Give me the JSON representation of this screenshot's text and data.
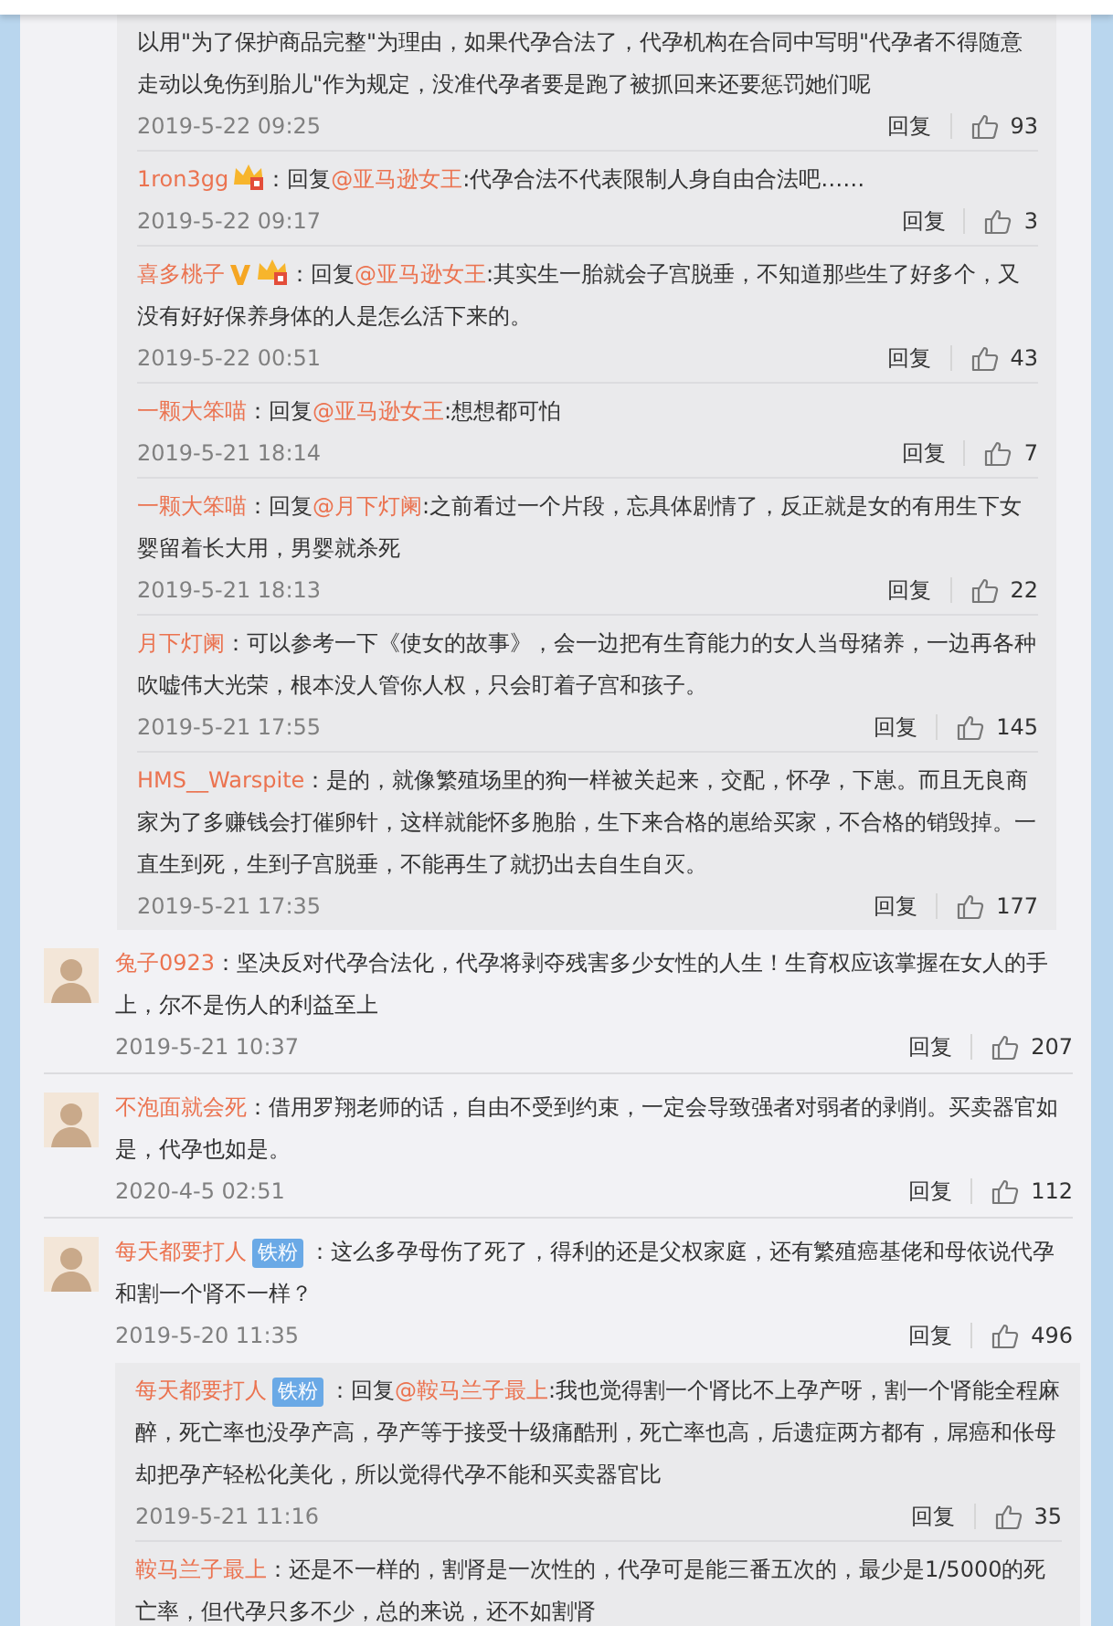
{
  "sections": [
    {
      "kind": "replies",
      "replies": [
        {
          "body": [
            {
              "kind": "text",
              "text": "以用\"为了保护商品完整\"为理由，如果代孕合法了，代孕机构在合同中写明\"代孕者不得随意走动以免伤到胎儿\"作为规定，没准代孕者要是跑了被抓回来还要惩罚她们呢"
            }
          ],
          "time": "2019-5-22 09:25",
          "reply_label": "回复",
          "likes": "93"
        },
        {
          "user": "1ron3gg",
          "badges": [
            {
              "kind": "level"
            }
          ],
          "body": [
            {
              "kind": "text",
              "text": "：回复"
            },
            {
              "kind": "mention",
              "text": "@亚马逊女王"
            },
            {
              "kind": "text",
              "text": ":代孕合法不代表限制人身自由合法吧……"
            }
          ],
          "time": "2019-5-22 09:17",
          "reply_label": "回复",
          "likes": "3"
        },
        {
          "user": "喜多桃子",
          "badges": [
            {
              "kind": "vip"
            },
            {
              "kind": "level"
            }
          ],
          "body": [
            {
              "kind": "text",
              "text": "：回复"
            },
            {
              "kind": "mention",
              "text": "@亚马逊女王"
            },
            {
              "kind": "text",
              "text": ":其实生一胎就会子宫脱垂，不知道那些生了好多个，又没有好好保养身体的人是怎么活下来的。"
            }
          ],
          "time": "2019-5-22 00:51",
          "reply_label": "回复",
          "likes": "43"
        },
        {
          "user": "一颗大笨喵",
          "body": [
            {
              "kind": "text",
              "text": "：回复"
            },
            {
              "kind": "mention",
              "text": "@亚马逊女王"
            },
            {
              "kind": "text",
              "text": ":想想都可怕"
            }
          ],
          "time": "2019-5-21 18:14",
          "reply_label": "回复",
          "likes": "7"
        },
        {
          "user": "一颗大笨喵",
          "body": [
            {
              "kind": "text",
              "text": "：回复"
            },
            {
              "kind": "mention",
              "text": "@月下灯阑"
            },
            {
              "kind": "text",
              "text": ":之前看过一个片段，忘具体剧情了，反正就是女的有用生下女婴留着长大用，男婴就杀死"
            }
          ],
          "time": "2019-5-21 18:13",
          "reply_label": "回复",
          "likes": "22"
        },
        {
          "user": "月下灯阑",
          "body": [
            {
              "kind": "text",
              "text": "：可以参考一下《使女的故事》，会一边把有生育能力的女人当母猪养，一边再各种吹嘘伟大光荣，根本没人管你人权，只会盯着子宫和孩子。"
            }
          ],
          "time": "2019-5-21 17:55",
          "reply_label": "回复",
          "likes": "145"
        },
        {
          "user": "HMS__Warspite",
          "body": [
            {
              "kind": "text",
              "text": "：是的，就像繁殖场里的狗一样被关起来，交配，怀孕，下崽。而且无良商家为了多赚钱会打催卵针，这样就能怀多胞胎，生下来合格的崽给买家，不合格的销毁掉。一直生到死，生到子宫脱垂，不能再生了就扔出去自生自灭。"
            }
          ],
          "time": "2019-5-21 17:35",
          "reply_label": "回复",
          "likes": "177"
        }
      ]
    },
    {
      "kind": "comment",
      "user": "兔子0923",
      "body": [
        {
          "kind": "text",
          "text": "：坚决反对代孕合法化，代孕将剥夺残害多少女性的人生！生育权应该掌握在女人的手上，尔不是伤人的利益至上"
        }
      ],
      "time": "2019-5-21 10:37",
      "reply_label": "回复",
      "likes": "207"
    },
    {
      "kind": "comment",
      "user": "不泡面就会死",
      "body": [
        {
          "kind": "text",
          "text": "：借用罗翔老师的话，自由不受到约束，一定会导致强者对弱者的剥削。买卖器官如是，代孕也如是。"
        }
      ],
      "time": "2020-4-5 02:51",
      "reply_label": "回复",
      "likes": "112"
    },
    {
      "kind": "comment",
      "user": "每天都要打人",
      "badges": [
        {
          "kind": "fan",
          "text": "铁粉"
        }
      ],
      "body": [
        {
          "kind": "text",
          "text": "：这么多孕母伤了死了，得利的还是父权家庭，还有繁殖癌基佬和母依说代孕和割一个肾不一样？"
        }
      ],
      "time": "2019-5-20 11:35",
      "reply_label": "回复",
      "likes": "496",
      "replies": [
        {
          "user": "每天都要打人",
          "badges": [
            {
              "kind": "fan",
              "text": "铁粉"
            }
          ],
          "body": [
            {
              "kind": "text",
              "text": "：回复"
            },
            {
              "kind": "mention",
              "text": "@鞍马兰子最上"
            },
            {
              "kind": "text",
              "text": ":我也觉得割一个肾比不上孕产呀，割一个肾能全程麻醉，死亡率也没孕产高，孕产等于接受十级痛酷刑，死亡率也高，后遗症两方都有，屌癌和伥母却把孕产轻松化美化，所以觉得代孕不能和买卖器官比"
            }
          ],
          "time": "2019-5-21 11:16",
          "reply_label": "回复",
          "likes": "35"
        },
        {
          "user": "鞍马兰子最上",
          "body": [
            {
              "kind": "text",
              "text": "：还是不一样的，割肾是一次性的，代孕可是能三番五次的，最少是1/5000的死亡率，但代孕只多不少，总的来说，还不如割肾"
            }
          ]
        }
      ]
    }
  ]
}
